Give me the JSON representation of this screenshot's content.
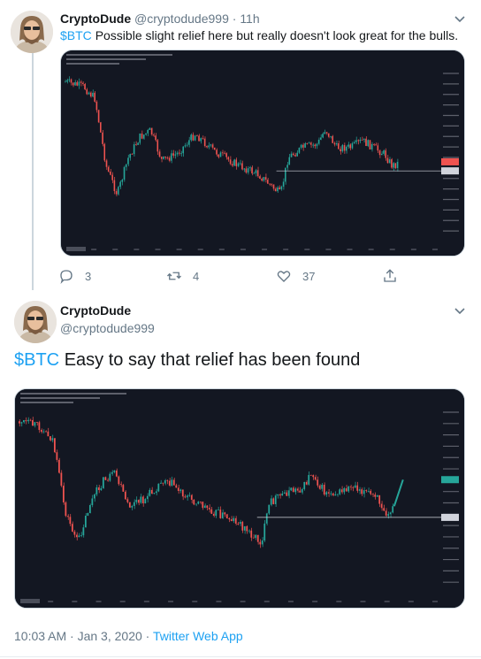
{
  "tweet1": {
    "display_name": "CryptoDude",
    "handle": "@cryptodude999",
    "separator": "·",
    "time_ago": "11h",
    "cashtag": "$BTC",
    "text": "Possible slight relief here but really doesn't look great for the bulls.",
    "counts": {
      "replies": "3",
      "retweets": "4",
      "likes": "37"
    },
    "icons": [
      "reply-icon",
      "retweet-icon",
      "like-icon",
      "share-icon",
      "chevron-down-icon"
    ]
  },
  "tweet2": {
    "display_name": "CryptoDude",
    "handle": "@cryptodude999",
    "cashtag": "$BTC",
    "text": "Easy to say that relief has been found",
    "timestamp": "10:03 AM · Jan 3, 2020",
    "separator": "·",
    "source": "Twitter Web App"
  },
  "colors": {
    "link_blue": "#1da1f2",
    "muted_gray": "#657786",
    "chart_background": "#131722",
    "candle_up": "#26a69a",
    "candle_down": "#ef5350"
  }
}
